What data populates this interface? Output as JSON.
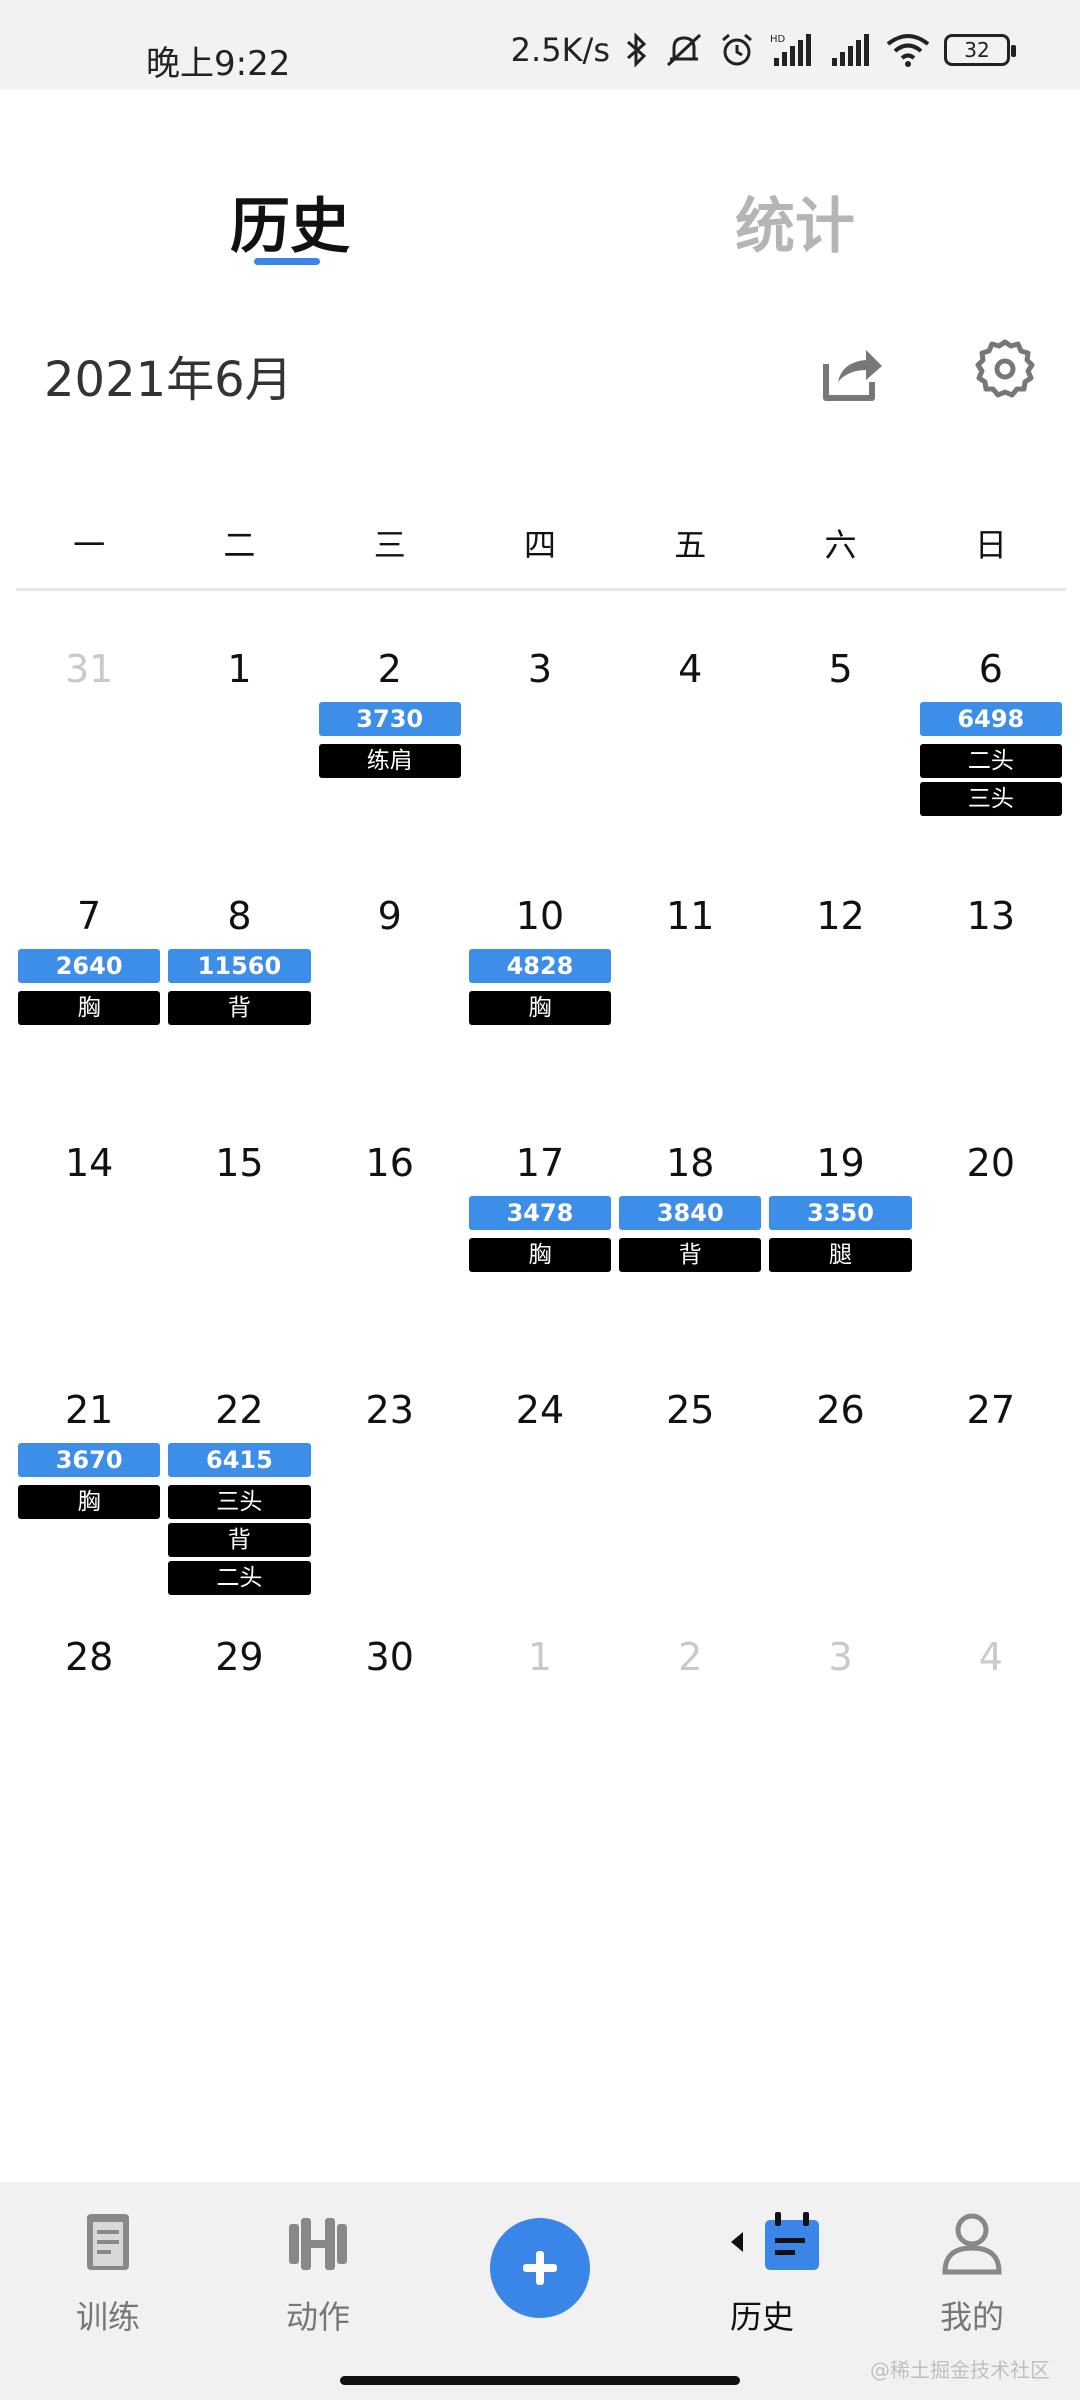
{
  "status_bar": {
    "time": "晚上9:22",
    "net_speed": "2.5K/s",
    "battery": "32"
  },
  "tabs": {
    "history": "历史",
    "stats": "统计"
  },
  "month": "2021年6月",
  "weekdays": [
    "一",
    "二",
    "三",
    "四",
    "五",
    "六",
    "日"
  ],
  "weeks": [
    [
      {
        "day": "31",
        "other": true,
        "vol": "",
        "parts": []
      },
      {
        "day": "1",
        "other": false,
        "vol": "",
        "parts": []
      },
      {
        "day": "2",
        "other": false,
        "vol": "3730",
        "parts": [
          "练肩"
        ]
      },
      {
        "day": "3",
        "other": false,
        "vol": "",
        "parts": []
      },
      {
        "day": "4",
        "other": false,
        "vol": "",
        "parts": []
      },
      {
        "day": "5",
        "other": false,
        "vol": "",
        "parts": []
      },
      {
        "day": "6",
        "other": false,
        "vol": "6498",
        "parts": [
          "二头",
          "三头"
        ]
      }
    ],
    [
      {
        "day": "7",
        "other": false,
        "vol": "2640",
        "parts": [
          "胸"
        ]
      },
      {
        "day": "8",
        "other": false,
        "vol": "11560",
        "parts": [
          "背"
        ]
      },
      {
        "day": "9",
        "other": false,
        "vol": "",
        "parts": []
      },
      {
        "day": "10",
        "other": false,
        "vol": "4828",
        "parts": [
          "胸"
        ]
      },
      {
        "day": "11",
        "other": false,
        "vol": "",
        "parts": []
      },
      {
        "day": "12",
        "other": false,
        "vol": "",
        "parts": []
      },
      {
        "day": "13",
        "other": false,
        "vol": "",
        "parts": []
      }
    ],
    [
      {
        "day": "14",
        "other": false,
        "vol": "",
        "parts": []
      },
      {
        "day": "15",
        "other": false,
        "vol": "",
        "parts": []
      },
      {
        "day": "16",
        "other": false,
        "vol": "",
        "parts": []
      },
      {
        "day": "17",
        "other": false,
        "vol": "3478",
        "parts": [
          "胸"
        ]
      },
      {
        "day": "18",
        "other": false,
        "vol": "3840",
        "parts": [
          "背"
        ]
      },
      {
        "day": "19",
        "other": false,
        "vol": "3350",
        "parts": [
          "腿"
        ]
      },
      {
        "day": "20",
        "other": false,
        "vol": "",
        "parts": []
      }
    ],
    [
      {
        "day": "21",
        "other": false,
        "vol": "3670",
        "parts": [
          "胸"
        ]
      },
      {
        "day": "22",
        "other": false,
        "vol": "6415",
        "parts": [
          "三头",
          "背",
          "二头"
        ]
      },
      {
        "day": "23",
        "other": false,
        "vol": "",
        "parts": []
      },
      {
        "day": "24",
        "other": false,
        "vol": "",
        "parts": []
      },
      {
        "day": "25",
        "other": false,
        "vol": "",
        "parts": []
      },
      {
        "day": "26",
        "other": false,
        "vol": "",
        "parts": []
      },
      {
        "day": "27",
        "other": false,
        "vol": "",
        "parts": []
      }
    ],
    [
      {
        "day": "28",
        "other": false,
        "vol": "",
        "parts": []
      },
      {
        "day": "29",
        "other": false,
        "vol": "",
        "parts": []
      },
      {
        "day": "30",
        "other": false,
        "vol": "",
        "parts": []
      },
      {
        "day": "1",
        "other": true,
        "vol": "",
        "parts": []
      },
      {
        "day": "2",
        "other": true,
        "vol": "",
        "parts": []
      },
      {
        "day": "3",
        "other": true,
        "vol": "",
        "parts": []
      },
      {
        "day": "4",
        "other": true,
        "vol": "",
        "parts": []
      }
    ]
  ],
  "bottom_nav": {
    "training": "训练",
    "actions": "动作",
    "history": "历史",
    "mine": "我的"
  },
  "watermark": "@稀土掘金技术社区",
  "colors": {
    "accent": "#3a86e8",
    "volume_badge": "#3d8ee8",
    "part_badge": "#000000"
  }
}
